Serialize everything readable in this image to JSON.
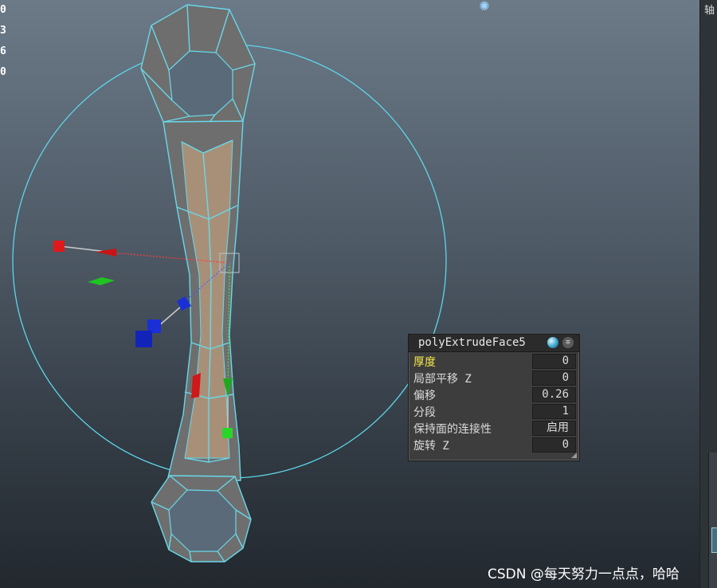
{
  "hud_left": {
    "digits": [
      "0",
      "3",
      "6",
      "0"
    ]
  },
  "right_panel": {
    "glyph": "轴"
  },
  "spinner": {
    "icon": "spinner-icon"
  },
  "extrude_hud": {
    "title": "polyExtrudeFace5",
    "icons": [
      "sphere-icon",
      "menu-icon"
    ],
    "rows": [
      {
        "label": "厚度",
        "value": "0",
        "selected": true
      },
      {
        "label": "局部平移 Z",
        "value": "0",
        "selected": false
      },
      {
        "label": "偏移",
        "value": "0.26",
        "selected": false
      },
      {
        "label": "分段",
        "value": "1",
        "selected": false
      },
      {
        "label": "保持面的连接性",
        "value": "启用",
        "selected": false
      },
      {
        "label": "旋转 Z",
        "value": "0",
        "selected": false
      }
    ]
  },
  "colors": {
    "wire": "#5cd6e8",
    "mesh_face": "#6e6e6e",
    "selected_face": "#b3967a",
    "manip_x": "#e01a1a",
    "manip_y": "#1fc41f",
    "manip_z": "#1a2fd6",
    "highlight_label": "#f5e64a"
  },
  "watermark": "CSDN @每天努力一点点，哈哈"
}
